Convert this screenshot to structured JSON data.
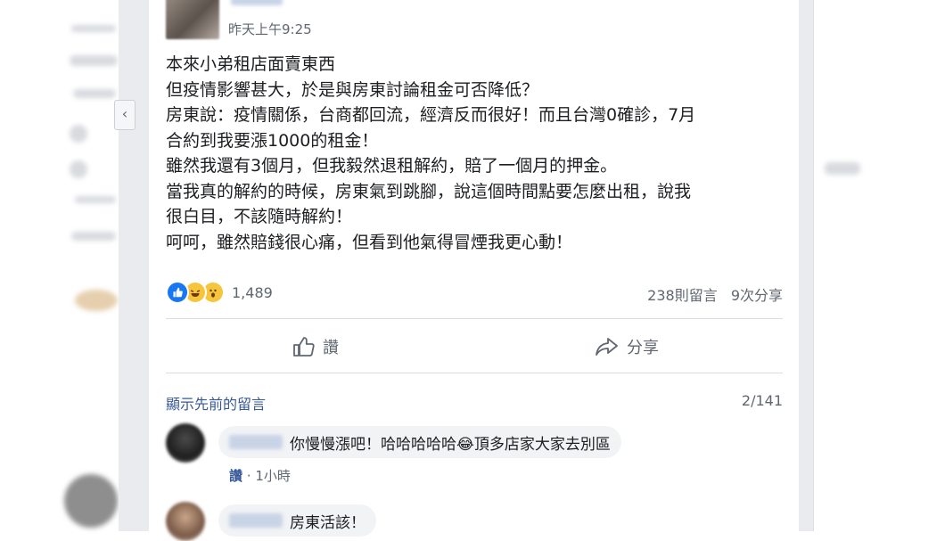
{
  "post": {
    "timestamp": "昨天上午9:25",
    "lines": [
      "本來小弟租店面賣東西",
      "但疫情影響甚大，於是與房東討論租金可否降低？",
      "房東說：疫情關係，台商都回流，經濟反而很好！而且台灣0確診，7月",
      "合約到我要漲1000的租金！",
      "雖然我還有3個月，但我毅然退租解約，賠了一個月的押金。",
      "當我真的解約的時候，房東氣到跳腳，說這個時間點要怎麼出租，說我",
      "很白目，不該隨時解約！",
      "呵呵，雖然賠錢很心痛，但看到他氣得冒煙我更心動！"
    ]
  },
  "reactions": {
    "count": "1,489",
    "comments": "238則留言",
    "shares": "9次分享",
    "icons": [
      "like-icon",
      "haha-icon",
      "wow-icon"
    ]
  },
  "actions": {
    "like_label": "讚",
    "share_label": "分享"
  },
  "comments_section": {
    "show_previous": "顯示先前的留言",
    "pager": "2/141",
    "items": [
      {
        "text": "你慢慢漲吧！哈哈哈哈哈😂頂多店家大家去別區",
        "like_label": "讚",
        "time": "· 1小時"
      },
      {
        "text": "房東活該！"
      }
    ]
  },
  "colors": {
    "link": "#385898",
    "muted": "#606770",
    "bubble": "#f2f3f5",
    "like_blue": "#1877f2"
  }
}
